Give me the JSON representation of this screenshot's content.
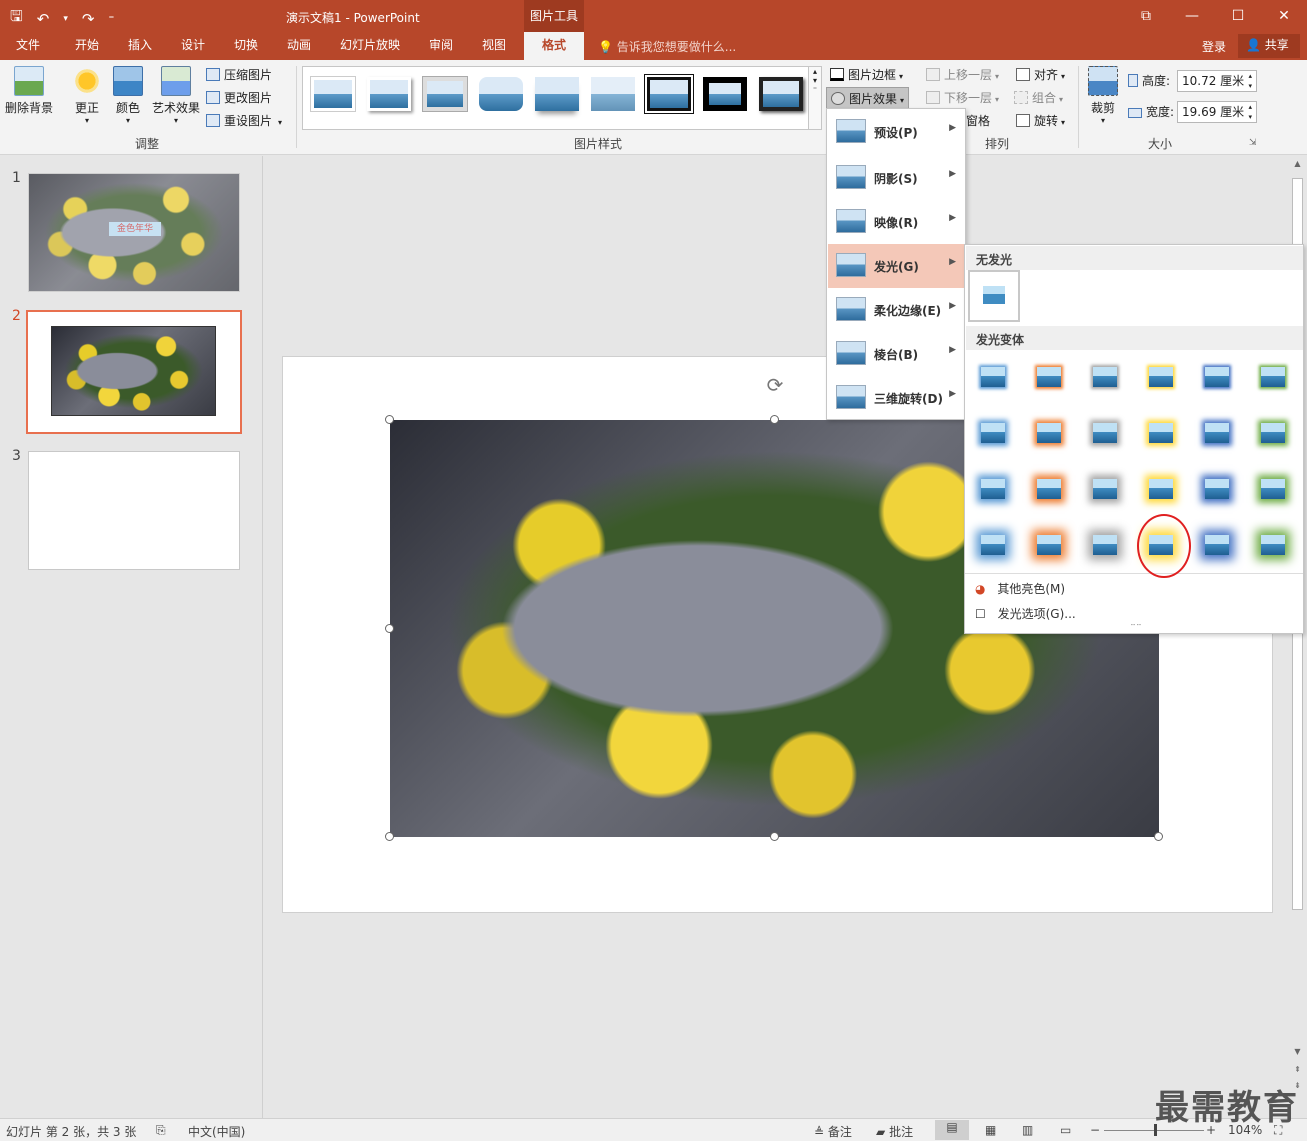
{
  "window": {
    "title": "演示文稿1 - PowerPoint",
    "context_title": "图片工具",
    "controls": [
      "⧉",
      "—",
      "☐",
      "✕"
    ]
  },
  "qat": {
    "save": "🖫",
    "undo": "↶",
    "undo_drop": "▾",
    "redo": "↷",
    "customize": "⁼"
  },
  "tabs": [
    "文件",
    "开始",
    "插入",
    "设计",
    "切换",
    "动画",
    "幻灯片放映",
    "审阅",
    "视图",
    "格式"
  ],
  "tellme": "告诉我您想要做什么...",
  "login": "登录",
  "share": "共享",
  "ribbon": {
    "remove_bg": "删除背景",
    "corrections": "更正",
    "color": "颜色",
    "artistic": "艺术效果",
    "compress": "压缩图片",
    "change": "更改图片",
    "reset": "重设图片",
    "group_adjust": "调整",
    "group_styles": "图片样式",
    "border": "图片边框",
    "effects": "图片效果",
    "bring_forward": "上移一层",
    "send_backward": "下移一层",
    "selection_pane": "窗格",
    "align": "对齐",
    "group": "组合",
    "rotate": "旋转",
    "group_arrange": "排列",
    "crop": "裁剪",
    "height_label": "高度:",
    "height_value": "10.72 厘米",
    "width_label": "宽度:",
    "width_value": "19.69 厘米",
    "group_size": "大小"
  },
  "slides": [
    {
      "num": "1",
      "overlay_text": "金色年华"
    },
    {
      "num": "2"
    },
    {
      "num": "3"
    }
  ],
  "effects_menu": [
    {
      "label": "预设(P)"
    },
    {
      "label": "阴影(S)"
    },
    {
      "label": "映像(R)"
    },
    {
      "label": "发光(G)"
    },
    {
      "label": "柔化边缘(E)"
    },
    {
      "label": "棱台(B)"
    },
    {
      "label": "三维旋转(D)"
    }
  ],
  "glow": {
    "no_glow": "无发光",
    "variations": "发光变体",
    "more_colors": "其他亮色(M)",
    "options": "发光选项(G)...",
    "colors": [
      "#5b9bd5",
      "#ed7d31",
      "#a5a5a5",
      "#ffd93b",
      "#4472c4",
      "#70ad47"
    ],
    "selected_row": 4,
    "selected_col": 4
  },
  "status": {
    "slide_info": "幻灯片 第 2 张，共 3 张",
    "language": "中文(中国)",
    "notes": "备注",
    "comments": "批注",
    "zoom": "104%"
  },
  "watermark": "最需教育"
}
